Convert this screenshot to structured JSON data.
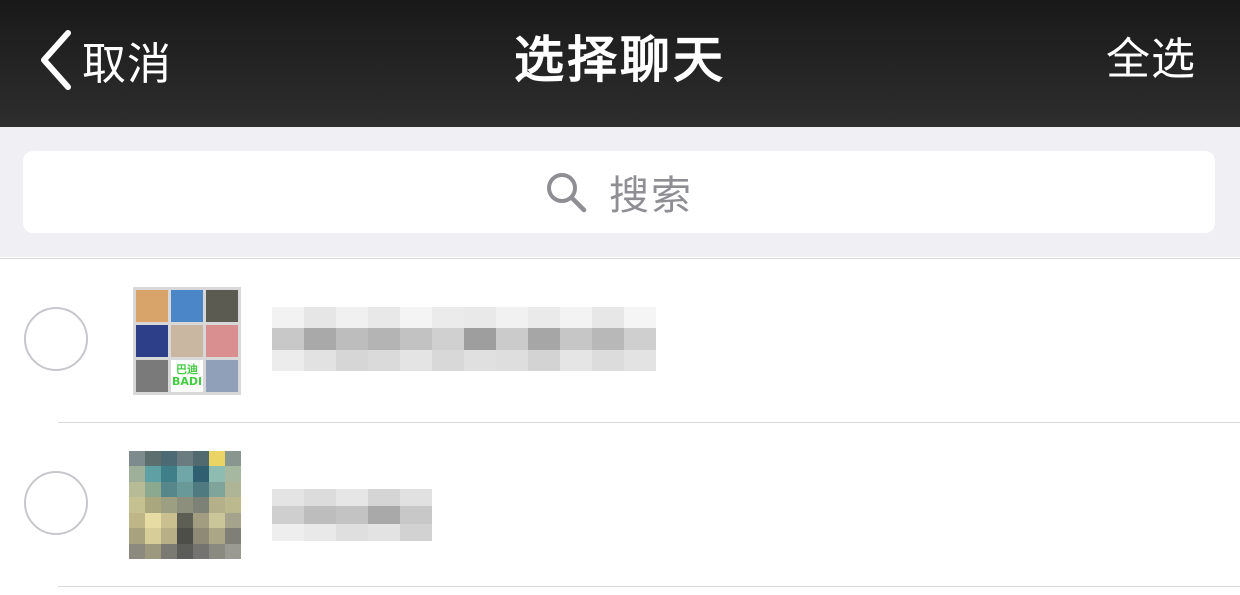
{
  "nav": {
    "back_label": "取消",
    "title": "选择聊天",
    "select_all_label": "全选"
  },
  "search": {
    "placeholder": "搜索"
  },
  "colors": {
    "nav_background": "#222222",
    "search_background": "#efeff4",
    "radio_border": "#c7c7cc",
    "placeholder_text": "#8e8e93"
  },
  "chats": [
    {
      "avatar": "group-avatar",
      "name_visible": false,
      "selected": false
    },
    {
      "avatar": "pixelated-avatar",
      "name_visible": false,
      "selected": false
    }
  ],
  "group_avatar_tile_text": [
    "巴迪",
    "BADI"
  ]
}
